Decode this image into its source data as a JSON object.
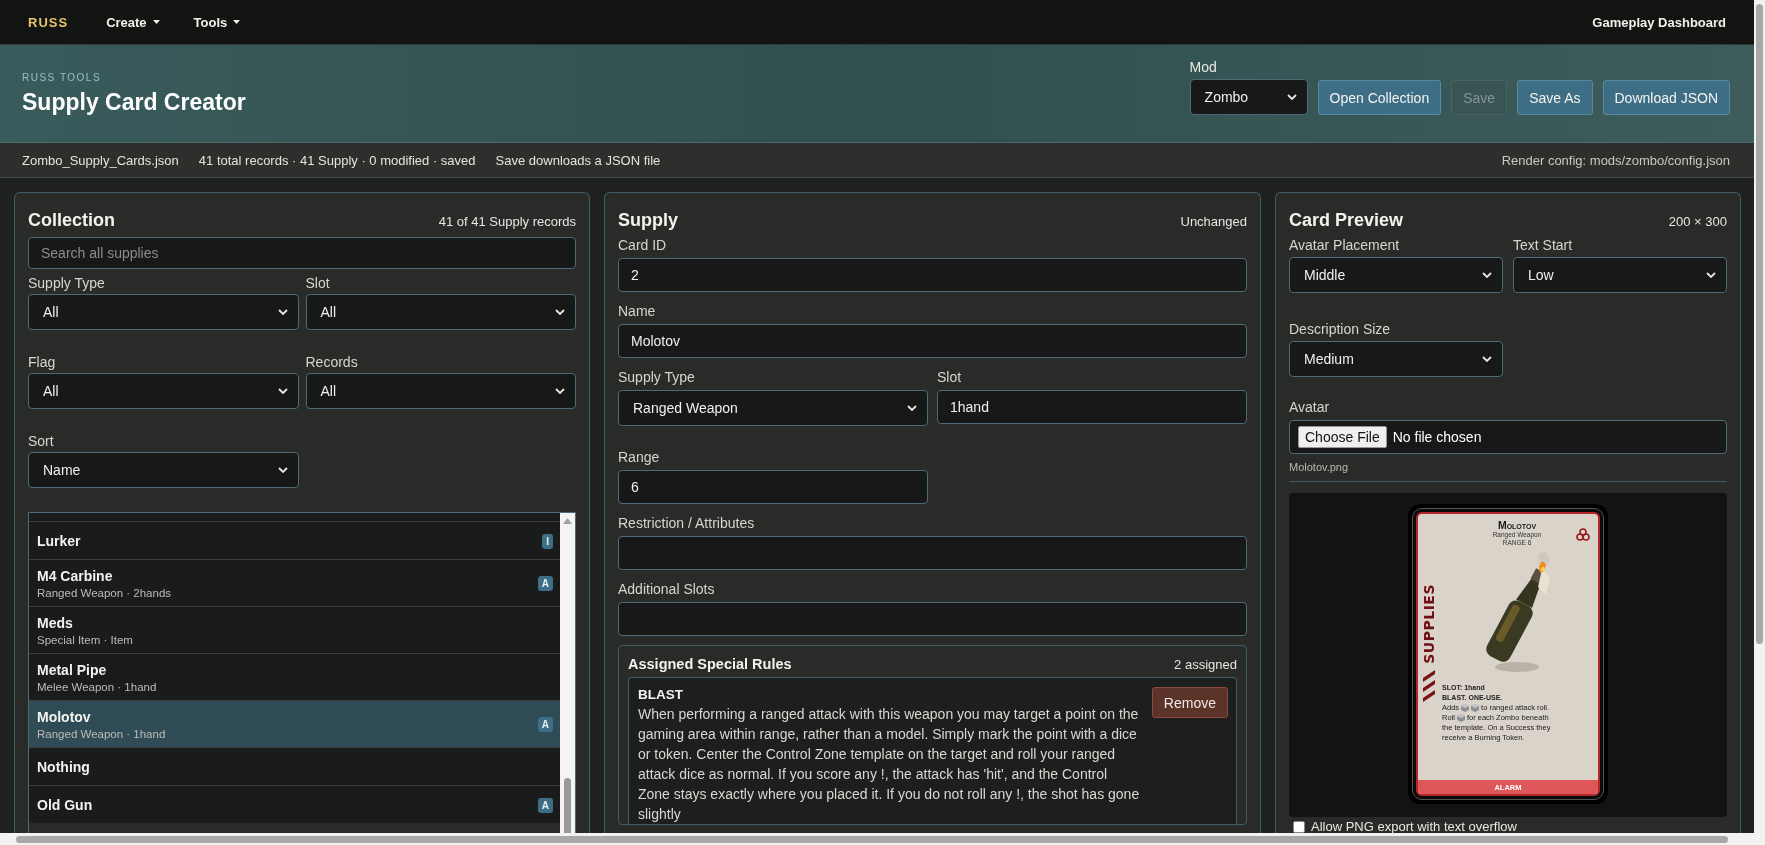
{
  "nav": {
    "brand": "RUSS",
    "menus": [
      {
        "label": "Create"
      },
      {
        "label": "Tools"
      }
    ],
    "dashboard_link": "Gameplay Dashboard"
  },
  "header": {
    "eyebrow": "RUSS TOOLS",
    "title": "Supply Card Creator",
    "mod": {
      "label": "Mod",
      "value": "Zombo"
    },
    "buttons": [
      {
        "label": "Open Collection",
        "disabled": false
      },
      {
        "label": "Save",
        "disabled": true
      },
      {
        "label": "Save As",
        "disabled": false
      },
      {
        "label": "Download JSON",
        "disabled": false
      }
    ]
  },
  "info_bar": {
    "items": [
      "Zombo_Supply_Cards.json",
      "41 total records · 41 Supply · 0 modified · saved",
      "Save downloads a JSON file"
    ],
    "render_config": "Render config: mods/zombo/config.json"
  },
  "collection": {
    "title": "Collection",
    "count": "41 of 41 Supply records",
    "search": {
      "placeholder": "Search all supplies"
    },
    "filters": [
      {
        "label": "Supply Type",
        "value": "All"
      },
      {
        "label": "Slot",
        "value": "All"
      },
      {
        "label": "Flag",
        "value": "All"
      },
      {
        "label": "Records",
        "value": "All"
      },
      {
        "label": "Sort",
        "value": "Name"
      }
    ],
    "items": [
      {
        "name": "Lurker",
        "badge": "I",
        "selected": false
      },
      {
        "name": "M4 Carbine",
        "subtitle": "Ranged Weapon · 2hands",
        "badge": "A",
        "selected": false
      },
      {
        "name": "Meds",
        "subtitle": "Special Item · Item",
        "selected": false
      },
      {
        "name": "Metal Pipe",
        "subtitle": "Melee Weapon · 1hand",
        "selected": false
      },
      {
        "name": "Molotov",
        "subtitle": "Ranged Weapon · 1hand",
        "badge": "A",
        "selected": true
      },
      {
        "name": "Nothing",
        "selected": false
      },
      {
        "name": "Old Gun",
        "badge": "A",
        "selected": false
      }
    ]
  },
  "supply": {
    "title": "Supply",
    "status": "Unchanged",
    "rows": [
      [
        {
          "label": "Card ID",
          "value": "2",
          "kind": "text"
        }
      ],
      [
        {
          "label": "Name",
          "value": "Molotov",
          "kind": "text"
        }
      ],
      [
        {
          "label": "Supply Type",
          "value": "Ranged Weapon",
          "kind": "select"
        },
        {
          "label": "Slot",
          "value": "1hand",
          "kind": "text"
        }
      ],
      [
        {
          "label": "Range",
          "value": "6",
          "kind": "number"
        }
      ],
      [
        {
          "label": "Restriction / Attributes",
          "kind": "text"
        }
      ],
      [
        {
          "label": "Additional Slots",
          "kind": "text"
        }
      ]
    ],
    "assigned": {
      "title": "Assigned Special Rules",
      "count": "2 assigned",
      "rules": [
        {
          "name": "BLAST",
          "text": "When performing a ranged attack with this weapon you may target a point on the gaming area within range, rather than a model. Simply mark the point with a dice or token. Center the Control Zone template on the target and roll your ranged attack dice as normal. If you score any !, the attack has 'hit', and the Control Zone stays exactly where you placed it. If you do not roll any !, the shot has gone slightly",
          "action": "Remove"
        }
      ]
    }
  },
  "preview": {
    "title": "Card Preview",
    "size": "200 × 300",
    "options": [
      {
        "label": "Avatar Placement",
        "value": "Middle"
      },
      {
        "label": "Text Start",
        "value": "Low"
      },
      {
        "label": "Description Size",
        "value": "Medium"
      }
    ],
    "avatar": {
      "label": "Avatar",
      "button": "Choose File",
      "status": "No file chosen",
      "file_name": "Molotov.png"
    },
    "card": {
      "name": "Molotov",
      "type": "Ranged Weapon",
      "range": "RANGE 6",
      "side_label": "SUPPLIES",
      "slot": "SLOT: 1hand",
      "keywords": "BLAST. ONE-USE.",
      "lines": [
        [
          {
            "kind": "text",
            "text": "Adds"
          },
          {
            "kind": "die"
          },
          {
            "kind": "die"
          },
          {
            "kind": "text",
            "text": "to ranged attack roll."
          }
        ],
        [
          {
            "kind": "text",
            "text": "Roll"
          },
          {
            "kind": "die"
          },
          {
            "kind": "text",
            "text": "for each Zombo beneath"
          }
        ],
        [
          {
            "kind": "text",
            "text": "the template. On a Success they"
          }
        ],
        [
          {
            "kind": "text",
            "text": "receive a Burning Token."
          }
        ]
      ],
      "footer": "ALARM"
    },
    "allow_overflow": {
      "label": "Allow PNG export with text overflow",
      "checked": false
    }
  }
}
